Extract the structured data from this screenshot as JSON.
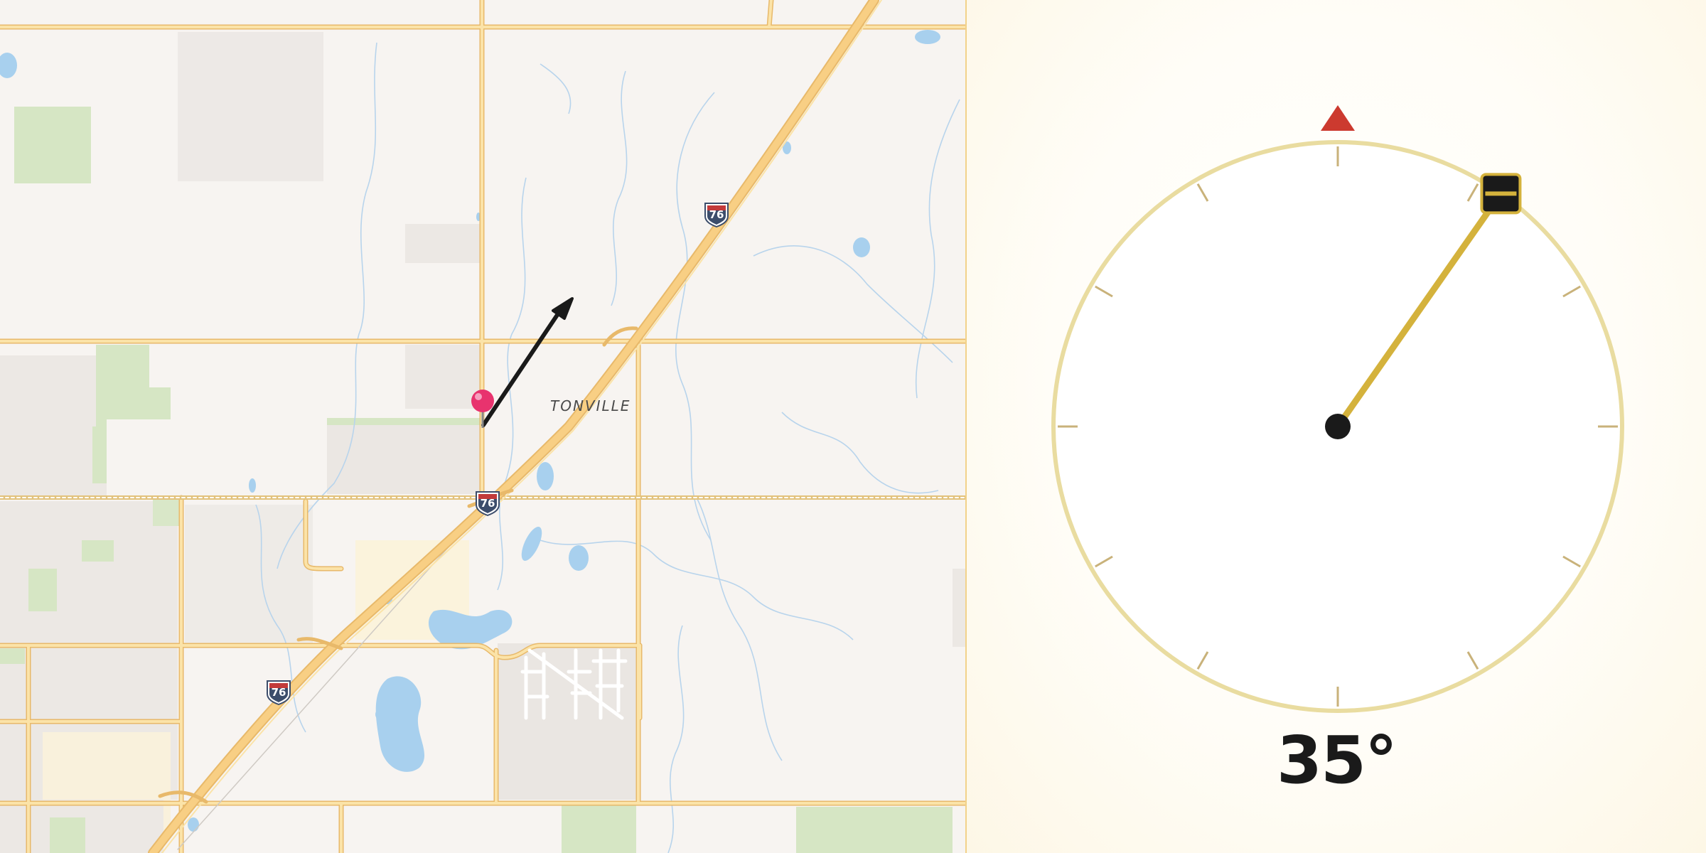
{
  "map": {
    "place_label": "TONVILLE",
    "highway_shield": "76",
    "colors": {
      "background": "#f7f4f1",
      "road": "#f6d38c",
      "road_edge": "#e8b96a",
      "interstate": "#f5c77a",
      "water": "#a8d0ee",
      "park": "#d6e6c4",
      "urban": "#ece8e4",
      "stream": "#b8d4ec",
      "pin": "#e8336e",
      "arrow": "#1a1a1a"
    },
    "icons": {
      "pin": "location-pin-icon",
      "direction": "direction-arrow-icon"
    }
  },
  "compass": {
    "heading_deg": 35,
    "heading_label": "35°",
    "colors": {
      "ring": "#e9dca0",
      "needle": "#d4b23c",
      "north_marker": "#cc3a2f",
      "hub": "#1a1a1a",
      "tick": "#c9b27a"
    }
  }
}
